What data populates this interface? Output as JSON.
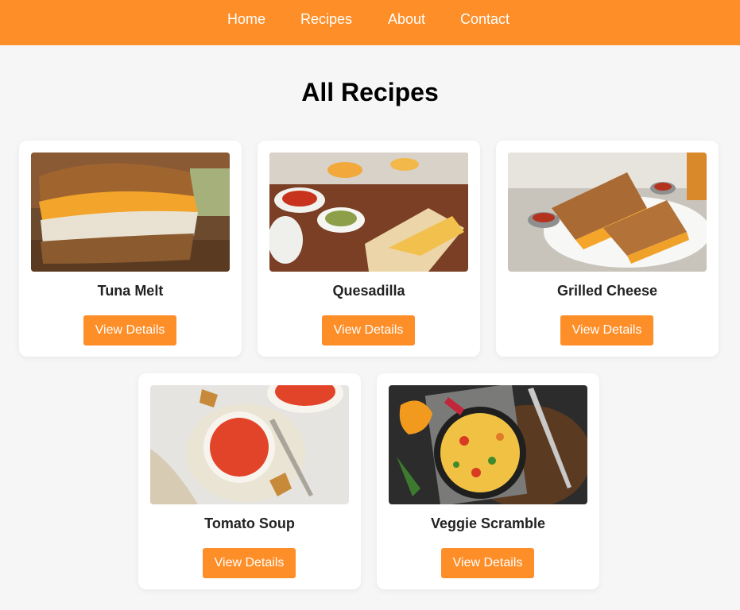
{
  "nav": {
    "home": "Home",
    "recipes": "Recipes",
    "about": "About",
    "contact": "Contact"
  },
  "page": {
    "title": "All Recipes"
  },
  "recipes": [
    {
      "name": "Tuna Melt",
      "button": "View Details"
    },
    {
      "name": "Quesadilla",
      "button": "View Details"
    },
    {
      "name": "Grilled Cheese",
      "button": "View Details"
    },
    {
      "name": "Tomato Soup",
      "button": "View Details"
    },
    {
      "name": "Veggie Scramble",
      "button": "View Details"
    }
  ],
  "colors": {
    "accent": "#fd8e28",
    "background": "#f6f6f6",
    "card": "#ffffff"
  }
}
